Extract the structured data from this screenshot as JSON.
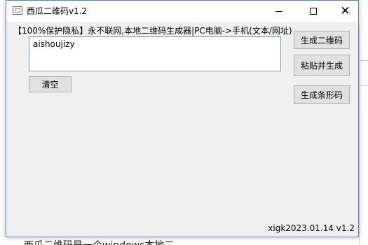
{
  "window": {
    "title": "西瓜二维码v1.2",
    "info_text": "【100%保护隐私】永不联网,本地二维码生成器|PC电脑->手机(文本/网址)",
    "version_text": "xigk2023.01.14 v1.2"
  },
  "titlebar_buttons": {
    "minimize": "minimize",
    "maximize": "maximize",
    "close": "✕"
  },
  "input": {
    "value": "aishoujizy"
  },
  "buttons": {
    "clear": "清空",
    "generate_qr": "生成二维码",
    "paste_generate": "粘贴并生成",
    "generate_barcode": "生成条形码"
  },
  "background": {
    "text": "西瓜二维码是一个windows本地二"
  }
}
